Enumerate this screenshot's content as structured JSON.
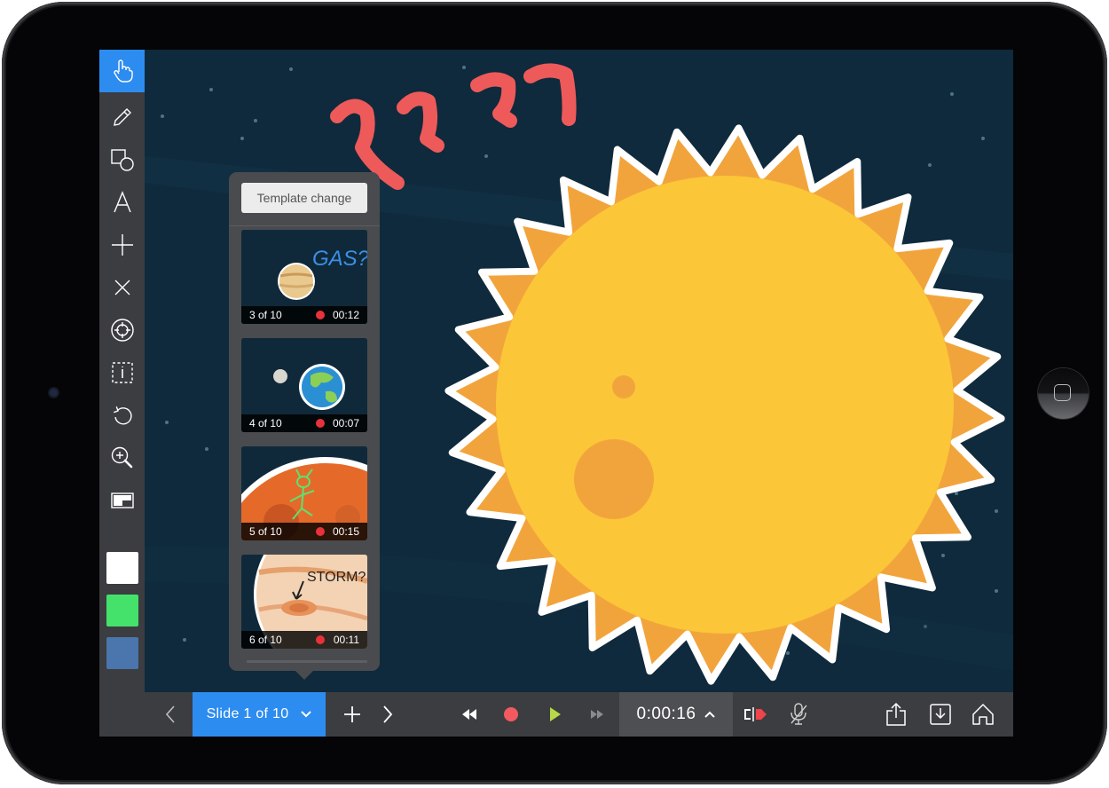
{
  "device": {
    "type": "tablet",
    "home_button": "home-button"
  },
  "toolbar": {
    "tools": [
      {
        "name": "hand-tool",
        "icon": "hand-pointer-icon",
        "active": true
      },
      {
        "name": "pen-tool",
        "icon": "pencil-icon",
        "active": false
      },
      {
        "name": "shape-tool",
        "icon": "shapes-icon",
        "active": false
      },
      {
        "name": "text-tool",
        "icon": "text-a-icon",
        "active": false
      },
      {
        "name": "add-tool",
        "icon": "plus-icon",
        "active": false
      },
      {
        "name": "delete-tool",
        "icon": "x-icon",
        "active": false
      },
      {
        "name": "pointer-tool",
        "icon": "crosshair-icon",
        "active": false
      },
      {
        "name": "info-select-tool",
        "icon": "dashed-info-icon",
        "active": false
      },
      {
        "name": "undo-tool",
        "icon": "undo-icon",
        "active": false
      },
      {
        "name": "zoom-tool",
        "icon": "zoom-in-icon",
        "active": false
      },
      {
        "name": "layout-tool",
        "icon": "picture-in-picture-icon",
        "active": false
      }
    ],
    "colors": [
      "#ffffff",
      "#44e26b",
      "#4a75ad"
    ]
  },
  "canvas": {
    "annotation_text": "????",
    "annotation_color": "#ee5a5a",
    "sun_colors": {
      "outer": "#f2a43c",
      "inner": "#fbc638",
      "spot": "#f2a43c",
      "outline": "#ffffff"
    },
    "background_color": "#0f2a3c"
  },
  "slide_panel": {
    "template_button": "Template change",
    "slides": [
      {
        "number_label": "3 of 10",
        "duration": "00:12",
        "recorded": true,
        "theme": "gas-giant",
        "annotation": "GAS?"
      },
      {
        "number_label": "4 of 10",
        "duration": "00:07",
        "recorded": true,
        "theme": "earth-moon",
        "annotation": ""
      },
      {
        "number_label": "5 of 10",
        "duration": "00:15",
        "recorded": true,
        "theme": "mars-alien",
        "annotation": ""
      },
      {
        "number_label": "6 of 10",
        "duration": "00:11",
        "recorded": true,
        "theme": "jupiter-storm",
        "annotation": "STORM?"
      }
    ]
  },
  "bottom_bar": {
    "prev_icon": "chevron-left-icon",
    "slide_selector": "Slide 1 of 10",
    "selector_icon": "chevron-down-icon",
    "add_icon": "plus-icon",
    "next_icon": "chevron-right-icon",
    "rewind_icon": "rewind-icon",
    "record_icon": "record-icon",
    "play_icon": "play-icon",
    "fast_forward_icon": "fast-forward-icon",
    "timer": "0:00:16",
    "timer_icon": "chevron-up-icon",
    "split_icon": "split-record-icon",
    "mic_icon": "mic-muted-icon",
    "share_icon": "share-icon",
    "import_icon": "import-icon",
    "home_icon": "home-icon",
    "accent": "#2d8cf0",
    "record_color": "#f25a5f",
    "play_color": "#b7d949"
  }
}
